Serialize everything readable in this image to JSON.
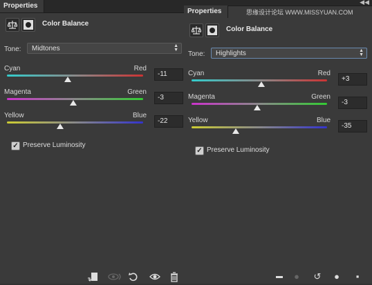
{
  "left_panel": {
    "tab_label": "Properties",
    "title": "Color Balance",
    "tone_label": "Tone:",
    "tone_value": "Midtones",
    "sliders": [
      {
        "left": "Cyan",
        "right": "Red",
        "value": "-11",
        "level": -11
      },
      {
        "left": "Magenta",
        "right": "Green",
        "value": "-3",
        "level": -3
      },
      {
        "left": "Yellow",
        "right": "Blue",
        "value": "-22",
        "level": -22
      }
    ],
    "preserve_label": "Preserve Luminosity"
  },
  "right_panel": {
    "tab_label": "Properties",
    "title": "Color Balance",
    "tone_label": "Tone:",
    "tone_value": "Highlights",
    "sliders": [
      {
        "left": "Cyan",
        "right": "Red",
        "value": "+3",
        "level": 3
      },
      {
        "left": "Magenta",
        "right": "Green",
        "value": "-3",
        "level": -3
      },
      {
        "left": "Yellow",
        "right": "Blue",
        "value": "-35",
        "level": -35
      }
    ],
    "preserve_label": "Preserve Luminosity",
    "watermark": "思缘设计论坛 WWW.MISSYUAN.COM"
  },
  "icons": {
    "scale": "scale-icon",
    "mask": "mask-icon",
    "clip": "clip-to-layer-icon",
    "eye_prev": "view-previous-state-icon",
    "reset": "reset-icon",
    "visibility": "eye-icon",
    "trash": "trash-icon"
  },
  "colors": {
    "cyan_red": [
      "#33cccc",
      "#cc3333"
    ],
    "magenta_green": [
      "#cc33cc",
      "#33cc33"
    ],
    "yellow_blue": [
      "#cccc33",
      "#3333cc"
    ]
  }
}
